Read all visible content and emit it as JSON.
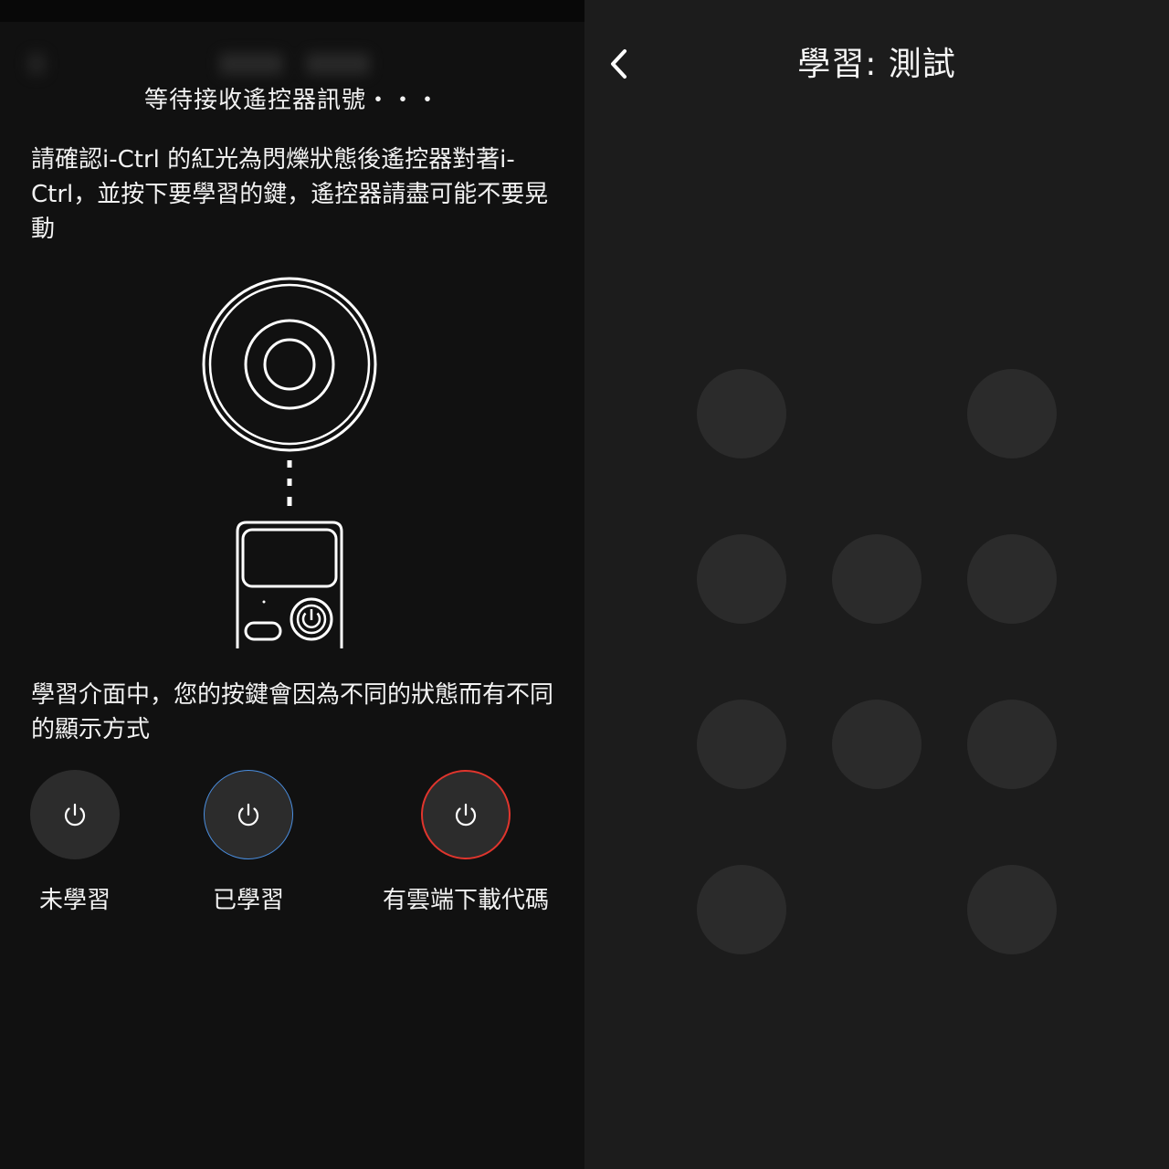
{
  "left_panel": {
    "waiting_text": "等待接收遙控器訊號・・・",
    "instruction_text": "請確認i-Ctrl 的紅光為閃爍狀態後遙控器對著i-Ctrl，並按下要學習的鍵，遙控器請盡可能不要晃動",
    "legend_text": "學習介面中，您的按鍵會因為不同的狀態而有不同的顯示方式",
    "legend": [
      {
        "label": "未學習",
        "icon": "power-icon",
        "ring_color": ""
      },
      {
        "label": "已學習",
        "icon": "power-icon",
        "ring_color": "#4a8ee0"
      },
      {
        "label": "有雲端下載代碼",
        "icon": "power-icon",
        "ring_color": "#e0352d"
      }
    ]
  },
  "right_panel": {
    "title": "學習: 測試",
    "back_icon": "chevron-left-icon",
    "button_grid": [
      [
        "button",
        "",
        "button"
      ],
      [
        "button",
        "button",
        "button"
      ],
      [
        "button",
        "button",
        "button"
      ],
      [
        "button",
        "",
        "button"
      ]
    ]
  },
  "colors": {
    "learned_ring": "#4a8ee0",
    "cloud_ring": "#e0352d",
    "button_fill": "#2b2b2b"
  }
}
